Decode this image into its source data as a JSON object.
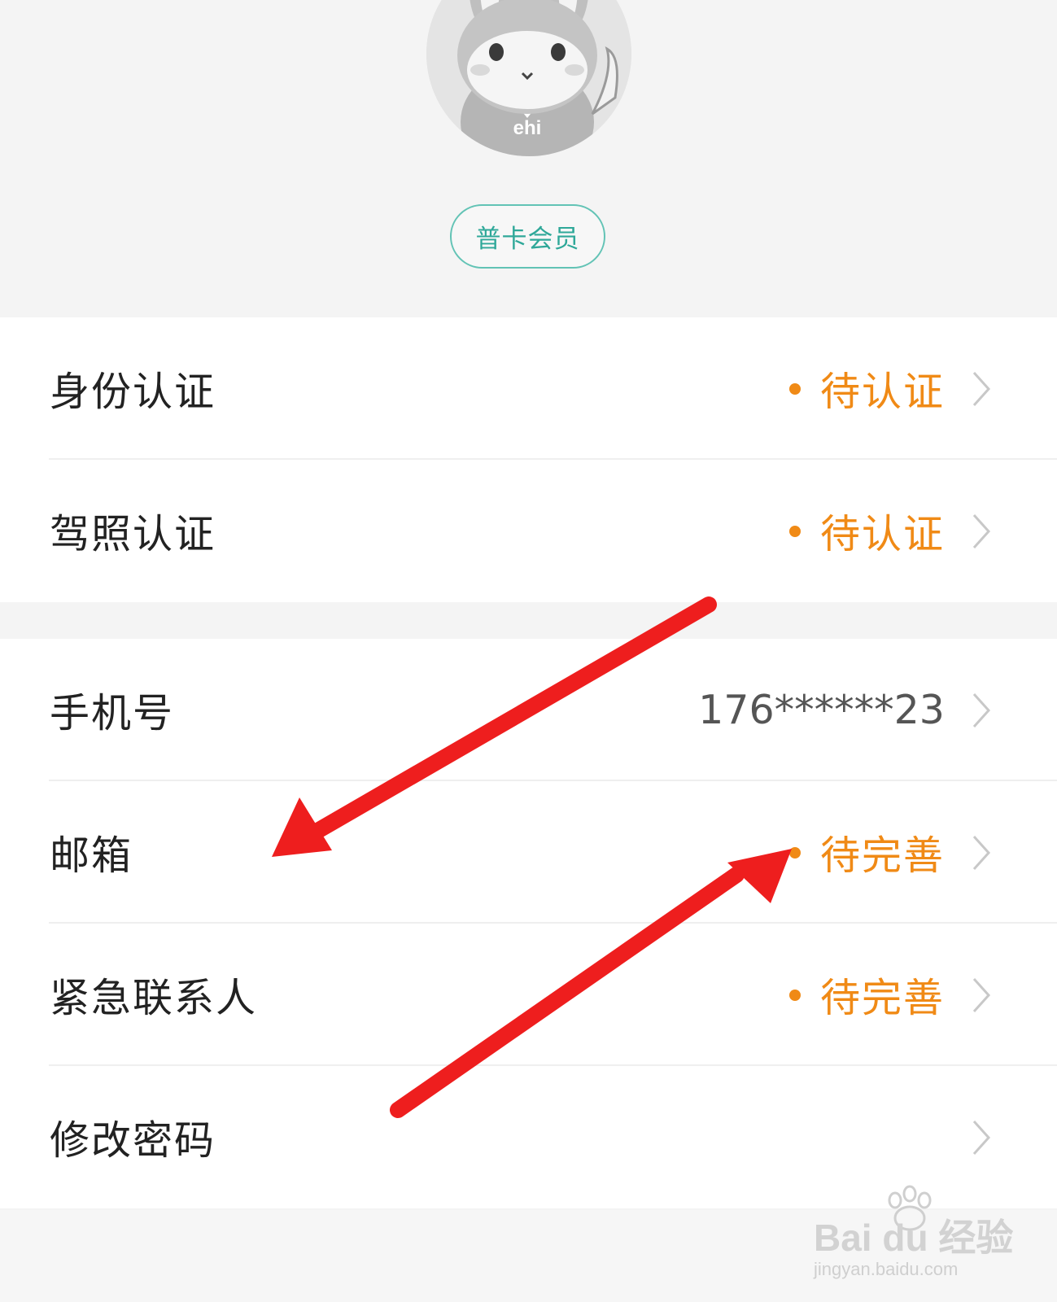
{
  "profile": {
    "membership_badge": "普卡会员"
  },
  "verification": [
    {
      "label": "身份认证",
      "status": "待认证"
    },
    {
      "label": "驾照认证",
      "status": "待认证"
    }
  ],
  "account": {
    "phone": {
      "label": "手机号",
      "value": "176******23"
    },
    "email": {
      "label": "邮箱",
      "status": "待完善"
    },
    "emergency_contact": {
      "label": "紧急联系人",
      "status": "待完善"
    },
    "password": {
      "label": "修改密码"
    }
  },
  "avatar_text": "ehi",
  "watermark": {
    "brand": "Bai du 经验",
    "url": "jingyan.baidu.com"
  },
  "colors": {
    "status_orange": "#f08a16",
    "badge_teal": "#2fa899",
    "annotation_arrow": "#ee1e1e"
  },
  "icons": {
    "row_arrow": "chevron-right-icon"
  }
}
